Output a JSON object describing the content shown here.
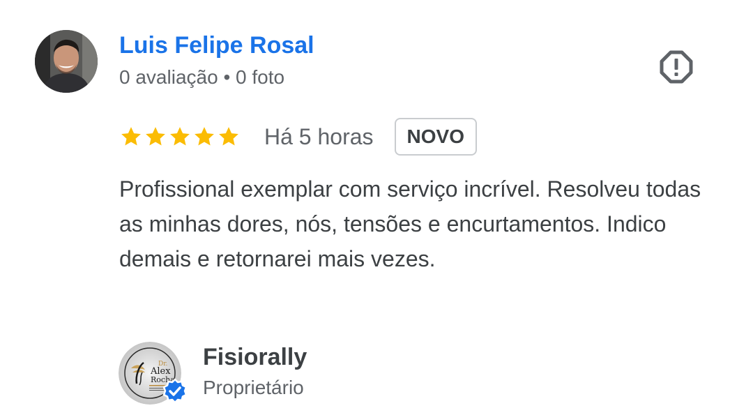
{
  "review": {
    "reviewer": {
      "name": "Luis Felipe Rosal",
      "reviews_count_text": "0 avaliação",
      "separator": "•",
      "photos_count_text": "0 foto",
      "avatar_icon": "person-photo"
    },
    "rating": {
      "stars": 5,
      "max_stars": 5,
      "star_color": "#fbbc04"
    },
    "time_text": "Há 5 horas",
    "badge": "NOVO",
    "text": "Profissional exemplar com serviço incrível. Resolveu todas as minhas dores, nós, tensões e encurtamentos. Indico demais e retornarei mais vezes.",
    "report_icon": "report-octagon-icon"
  },
  "owner_response": {
    "name": "Fisiorally",
    "role": "Proprietário",
    "logo_text": {
      "title": "Dr.",
      "line1": "Alex",
      "line2": "Rocha"
    },
    "verified_icon": "verified-check-icon",
    "verified_color": "#1a73e8"
  },
  "colors": {
    "link_blue": "#1a73e8",
    "text_primary": "#3c4043",
    "text_secondary": "#5f6368"
  }
}
